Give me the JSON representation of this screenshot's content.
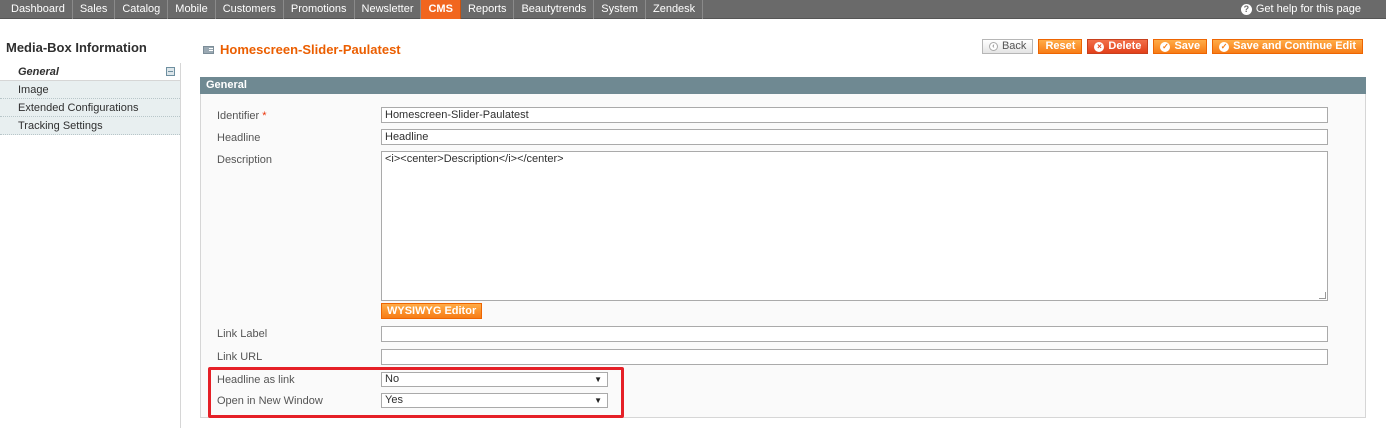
{
  "nav": {
    "items": [
      "Dashboard",
      "Sales",
      "Catalog",
      "Mobile",
      "Customers",
      "Promotions",
      "Newsletter",
      "CMS",
      "Reports",
      "Beautytrends",
      "System",
      "Zendesk"
    ],
    "active": "CMS",
    "help_label": "Get help for this page"
  },
  "sidebar": {
    "title": "Media-Box Information",
    "tabs": [
      {
        "label": "General",
        "active": true
      },
      {
        "label": "Image",
        "active": false
      },
      {
        "label": "Extended Configurations",
        "active": false
      },
      {
        "label": "Tracking Settings",
        "active": false
      }
    ]
  },
  "header": {
    "title": "Homescreen-Slider-Paulatest",
    "buttons": {
      "back": "Back",
      "reset": "Reset",
      "delete": "Delete",
      "save": "Save",
      "save_continue": "Save and Continue Edit"
    }
  },
  "form": {
    "section_title": "General",
    "identifier": {
      "label": "Identifier",
      "required_mark": "*",
      "value": "Homescreen-Slider-Paulatest"
    },
    "headline": {
      "label": "Headline",
      "value": "Headline"
    },
    "description": {
      "label": "Description",
      "value": "<i><center>Description</i></center>"
    },
    "wysiwyg_label": "WYSIWYG Editor",
    "link_label": {
      "label": "Link Label",
      "value": ""
    },
    "link_url": {
      "label": "Link URL",
      "value": ""
    },
    "headline_as_link": {
      "label": "Headline as link",
      "value": "No"
    },
    "open_new_window": {
      "label": "Open in New Window",
      "value": "Yes"
    }
  },
  "colors": {
    "accent": "#eb5e00",
    "nav_bg": "#6a6a6a",
    "section_head": "#6f8992",
    "highlight": "#e52027"
  }
}
